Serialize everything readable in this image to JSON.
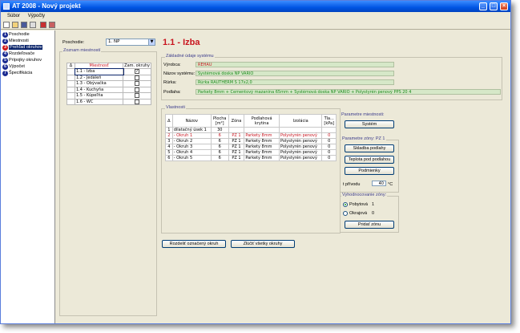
{
  "window": {
    "title": "AT 2008 - Nový projekt"
  },
  "menu": {
    "items": [
      "Súbor",
      "Výpočty"
    ]
  },
  "sidebar": {
    "items": [
      {
        "num": "1",
        "label": "Poschodie"
      },
      {
        "num": "2",
        "label": "Miestnosti"
      },
      {
        "num": "3",
        "label": "Prehľad okruhov"
      },
      {
        "num": "4",
        "label": "Rozdeľovače"
      },
      {
        "num": "5",
        "label": "Prípojky okruhov"
      },
      {
        "num": "6",
        "label": "Výpočet"
      },
      {
        "num": "7",
        "label": "Špecifikácia"
      }
    ],
    "active_index": 2
  },
  "floor": {
    "label": "Poschodie:",
    "value": "1. NP"
  },
  "rooms": {
    "group_title": "Zoznam miestností",
    "col_index": "Δ",
    "col_name": "Miestnosť",
    "col_cooling": "Zam. okruhy",
    "rows": [
      {
        "name": "1.1 - Izba",
        "checked": true
      },
      {
        "name": "1.2 - Jedáleň",
        "checked": false
      },
      {
        "name": "1.3 - Obývačka",
        "checked": false
      },
      {
        "name": "1.4 - Kuchyňa",
        "checked": false
      },
      {
        "name": "1.5 - Kúpeľňa",
        "checked": false
      },
      {
        "name": "1.6 - WC",
        "checked": false
      }
    ]
  },
  "room_title": "1.1 - Izba",
  "system": {
    "group_title": "Základné údaje systému",
    "manufacturer_label": "Výrobca:",
    "manufacturer": "REHAU",
    "system_label": "Názov systému:",
    "system_name": "Systémová doska NP VARIO",
    "pipe_label": "Rúrka:",
    "pipe": "Rúrka RAUTHERM S 17x2,0",
    "floor_label": "Podlaha:",
    "floor_value": "Parkety 8mm + Cementový mazanina 65mm + Systémová doska NP VARIO + Polystyrén penový PPS 20 4"
  },
  "properties": {
    "group_title": "Vlastnosti"
  },
  "circuits": {
    "headers": [
      "Δ",
      "Názov",
      "Plocha [m²]",
      "Zóna",
      "Podlahová krytina",
      "Izolácia",
      "Tla... [kPa]"
    ],
    "rows": [
      {
        "idx": "1",
        "name": "dilatačný úsek 1",
        "area": "30",
        "zone": "",
        "floor": "",
        "insulation": "",
        "pressure": "",
        "selected": false
      },
      {
        "idx": "2",
        "name": "- Okruh 1",
        "area": "6",
        "zone": "PZ 1",
        "floor": "Parkety 8mm",
        "insulation": "Polystyrén penový",
        "pressure": "0",
        "selected": true
      },
      {
        "idx": "3",
        "name": "- Okruh 2",
        "area": "6",
        "zone": "PZ 1",
        "floor": "Parkety 8mm",
        "insulation": "Polystyrén penový",
        "pressure": "0",
        "selected": false
      },
      {
        "idx": "4",
        "name": "- Okruh 3",
        "area": "6",
        "zone": "PZ 1",
        "floor": "Parkety 8mm",
        "insulation": "Polystyrén penový",
        "pressure": "0",
        "selected": false
      },
      {
        "idx": "5",
        "name": "- Okruh 4",
        "area": "6",
        "zone": "PZ 1",
        "floor": "Parkety 8mm",
        "insulation": "Polystyrén penový",
        "pressure": "0",
        "selected": false
      },
      {
        "idx": "6",
        "name": "- Okruh 5",
        "area": "6",
        "zone": "PZ 1",
        "floor": "Parkety 8mm",
        "insulation": "Polystyrén penový",
        "pressure": "0",
        "selected": false
      }
    ]
  },
  "buttons": {
    "split_marked": "Rozdeliť označený okruh",
    "merge_all": "Zlúčiť všetky okruhy"
  },
  "room_params": {
    "title": "Parametre miestnosti:",
    "system_btn": "Systém"
  },
  "zone_params": {
    "title": "Parametre zóny: PZ 1",
    "floor_layers_btn": "Skladba podlahy",
    "temp_btn": "Teplota pod podlahou",
    "conditions_btn": "Podmienky",
    "supply_label": "t přívodu",
    "supply_value": "40",
    "supply_unit": "°C"
  },
  "zone_eval": {
    "title": "Vyhodnocovanie zóny:",
    "heating_label": "Pobytová",
    "heating_value": "1",
    "edge_label": "Okrajová",
    "edge_value": "0",
    "add_zone_btn": "Pridať zónu"
  }
}
